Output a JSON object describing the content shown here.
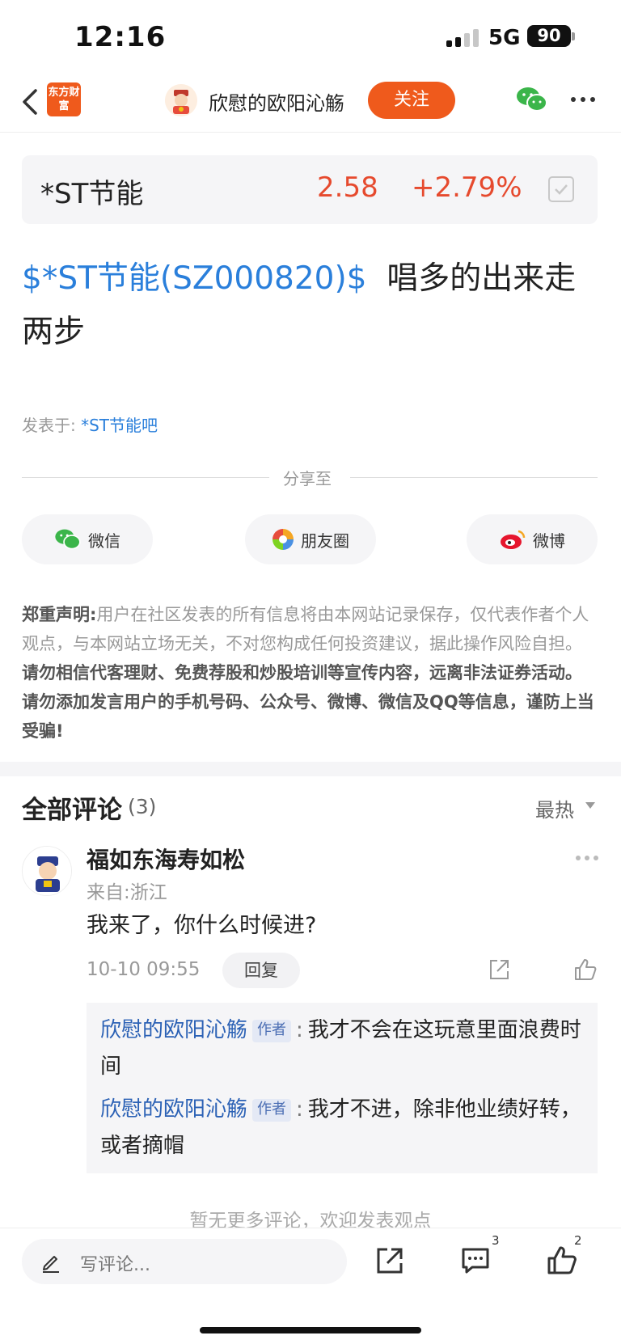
{
  "status": {
    "time": "12:16",
    "network": "5G",
    "battery": "90"
  },
  "nav": {
    "logo_text": "东方财富",
    "author": "欣慰的欧阳沁觞",
    "follow": "关注"
  },
  "stock": {
    "name": "*ST节能",
    "price": "2.58",
    "change": "+2.79%"
  },
  "post": {
    "tag": "$*ST节能(SZ000820)$",
    "text": "唱多的出来走两步",
    "posted_label": "发表于:",
    "posted_bar": "*ST节能吧"
  },
  "share": {
    "label": "分享至",
    "buttons": [
      "微信",
      "朋友圈",
      "微博"
    ]
  },
  "disclaimer": {
    "lead": "郑重声明:",
    "normal": "用户在社区发表的所有信息将由本网站记录保存，仅代表作者个人观点，与本网站立场无关，不对您构成任何投资建议，据此操作风险自担。",
    "strong": "请勿相信代客理财、免费荐股和炒股培训等宣传内容，远离非法证券活动。请勿添加发言用户的手机号码、公众号、微博、微信及QQ等信息，谨防上当受骗!"
  },
  "comments": {
    "title": "全部评论",
    "count": "(3)",
    "sort": "最热",
    "items": [
      {
        "user": "福如东海寿如松",
        "location": "来自:浙江",
        "text": "我来了，你什么时候进?",
        "time": "10-10 09:55",
        "reply_label": "回复",
        "replies": [
          {
            "name": "欣慰的欧阳沁觞",
            "badge": "作者",
            "colon": ":",
            "text": "我才不会在这玩意里面浪费时间"
          },
          {
            "name": "欣慰的欧阳沁觞",
            "badge": "作者",
            "colon": ":",
            "text": "我才不进，除非他业绩好转，或者摘帽"
          }
        ]
      }
    ],
    "no_more": "暂无更多评论，欢迎发表观点"
  },
  "bottom": {
    "placeholder": "写评论...",
    "comment_count": "3",
    "like_count": "2"
  },
  "colors": {
    "accent": "#ef5a1c",
    "up": "#e64a2e",
    "link": "#2a7fdb"
  }
}
